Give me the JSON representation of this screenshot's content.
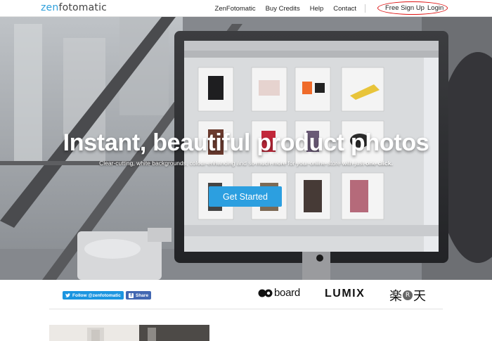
{
  "header": {
    "logo_part1": "zen",
    "logo_part2": "fotomatic",
    "nav": [
      "ZenFotomatic",
      "Buy Credits",
      "Help",
      "Contact"
    ],
    "free_signup": "Free Sign Up",
    "login": "Login"
  },
  "hero": {
    "title": "Instant, beautiful product photos",
    "subtitle": "Clear-cutting, white backgrounds, colour enhancing and so much more for your online store with just",
    "subtitle_bold": "one click.",
    "cta": "Get Started"
  },
  "social": {
    "twitter": "Follow @zenfotomatic",
    "facebook": "Share"
  },
  "partners": {
    "board": "board",
    "lumix": "LUMIX",
    "rakuten_left": "楽",
    "rakuten_mid": "R",
    "rakuten_right": "天"
  },
  "colors": {
    "accent": "#2c9fe0",
    "logo_blue": "#2ea0dc",
    "annotation": "#dd1111",
    "twitter": "#1b95e0",
    "facebook": "#4267b2"
  }
}
